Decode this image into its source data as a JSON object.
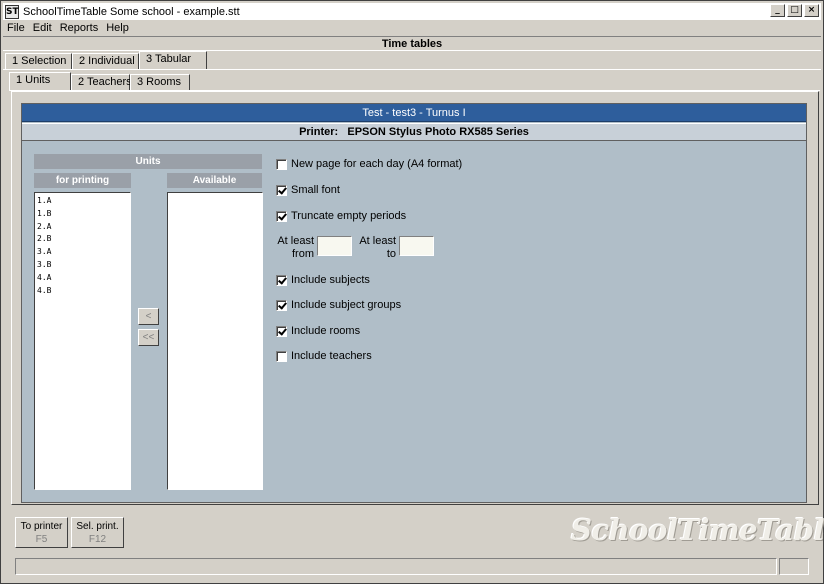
{
  "window": {
    "title": "SchoolTimeTable Some school - example.stt",
    "icon_text": "ST",
    "buttons": [
      "_",
      "□",
      "×"
    ]
  },
  "menu": [
    {
      "label": "File",
      "key": "F"
    },
    {
      "label": "Edit",
      "key": "E"
    },
    {
      "label": "Reports",
      "key": "R"
    },
    {
      "label": "Help",
      "key": "H"
    }
  ],
  "section_title": "Time tables",
  "main_tabs": [
    "1  Selection",
    "2  Individual",
    "3  Tabular"
  ],
  "sub_tabs": [
    "1   Units",
    "2  Teachers",
    "3   Rooms"
  ],
  "header": {
    "title": "Test - test3 - Turnus I",
    "printer_label": "Printer:",
    "printer_name": "EPSON Stylus Photo RX585 Series"
  },
  "units": {
    "heading": "Units",
    "for_printing_label": "for printing",
    "available_label": "Available",
    "for_printing": [
      "1.A",
      "1.B",
      "2.A",
      "2.B",
      "3.A",
      "3.B",
      "4.A",
      "4.B"
    ],
    "available": [],
    "move_one": "<",
    "move_all": "<<"
  },
  "options": {
    "new_page": {
      "label": "New page for each day (A4 format)",
      "checked": false
    },
    "small_font": {
      "label": "Small font",
      "checked": true
    },
    "truncate": {
      "label": "Truncate empty periods",
      "checked": true
    },
    "include_subjects": {
      "label": "Include subjects",
      "checked": true
    },
    "include_subject_groups": {
      "label": "Include subject groups",
      "checked": true
    },
    "include_rooms": {
      "label": "Include rooms",
      "checked": true
    },
    "include_teachers": {
      "label": "Include teachers",
      "checked": false
    }
  },
  "at_least": {
    "from_label_1": "At least",
    "from_label_2": "from",
    "to_label_1": "At least",
    "to_label_2": "to",
    "from_value": "",
    "to_value": ""
  },
  "buttons": {
    "to_printer": "To printer",
    "to_printer_key": "F5",
    "sel_print": "Sel. print.",
    "sel_print_key": "F12"
  },
  "watermark": "SchoolTimeTable"
}
